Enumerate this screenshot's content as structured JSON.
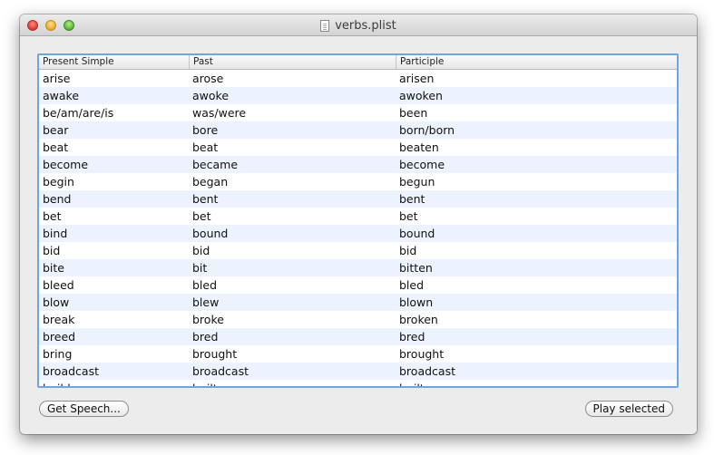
{
  "window": {
    "title": "verbs.plist"
  },
  "table": {
    "columns": [
      "Present Simple",
      "Past",
      "Participle"
    ],
    "rows": [
      [
        "arise",
        "arose",
        "arisen"
      ],
      [
        "awake",
        "awoke",
        "awoken"
      ],
      [
        "be/am/are/is",
        "was/were",
        "been"
      ],
      [
        "bear",
        "bore",
        "born/born"
      ],
      [
        "beat",
        "beat",
        "beaten"
      ],
      [
        "become",
        "became",
        "become"
      ],
      [
        "begin",
        "began",
        "begun"
      ],
      [
        "bend",
        "bent",
        "bent"
      ],
      [
        "bet",
        "bet",
        "bet"
      ],
      [
        "bind",
        "bound",
        "bound"
      ],
      [
        "bid",
        "bid",
        "bid"
      ],
      [
        "bite",
        "bit",
        "bitten"
      ],
      [
        "bleed",
        "bled",
        "bled"
      ],
      [
        "blow",
        "blew",
        "blown"
      ],
      [
        "break",
        "broke",
        "broken"
      ],
      [
        "breed",
        "bred",
        "bred"
      ],
      [
        "bring",
        "brought",
        "brought"
      ],
      [
        "broadcast",
        "broadcast",
        "broadcast"
      ],
      [
        "build",
        "built",
        "built"
      ]
    ]
  },
  "buttons": {
    "get_speech": "Get Speech...",
    "play_selected": "Play selected"
  },
  "colors": {
    "selection_border": "#6ea6df",
    "alt_row": "#edf3fe"
  }
}
